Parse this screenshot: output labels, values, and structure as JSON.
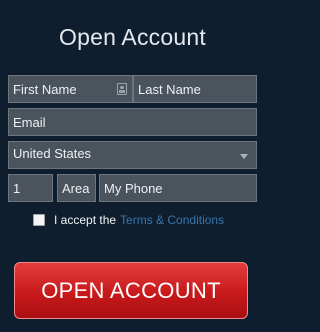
{
  "header": {
    "title": "Open Account"
  },
  "form": {
    "first_name": {
      "placeholder": "First Name",
      "icon": "contact-card-icon"
    },
    "last_name": {
      "placeholder": "Last Name"
    },
    "email": {
      "placeholder": "Email"
    },
    "country": {
      "selected": "United States",
      "icon": "chevron-down-icon"
    },
    "phone_code": {
      "value": "1"
    },
    "phone_area": {
      "placeholder": "Area"
    },
    "phone_number": {
      "placeholder": "My Phone"
    },
    "terms": {
      "checked": false,
      "prefix": "I accept the",
      "link": "Terms & Conditions"
    },
    "submit_label": "OPEN ACCOUNT"
  },
  "colors": {
    "background": "#0e1e2e",
    "field_background": "#4b545c",
    "link": "#3a74a8",
    "button": "#c8191b"
  }
}
